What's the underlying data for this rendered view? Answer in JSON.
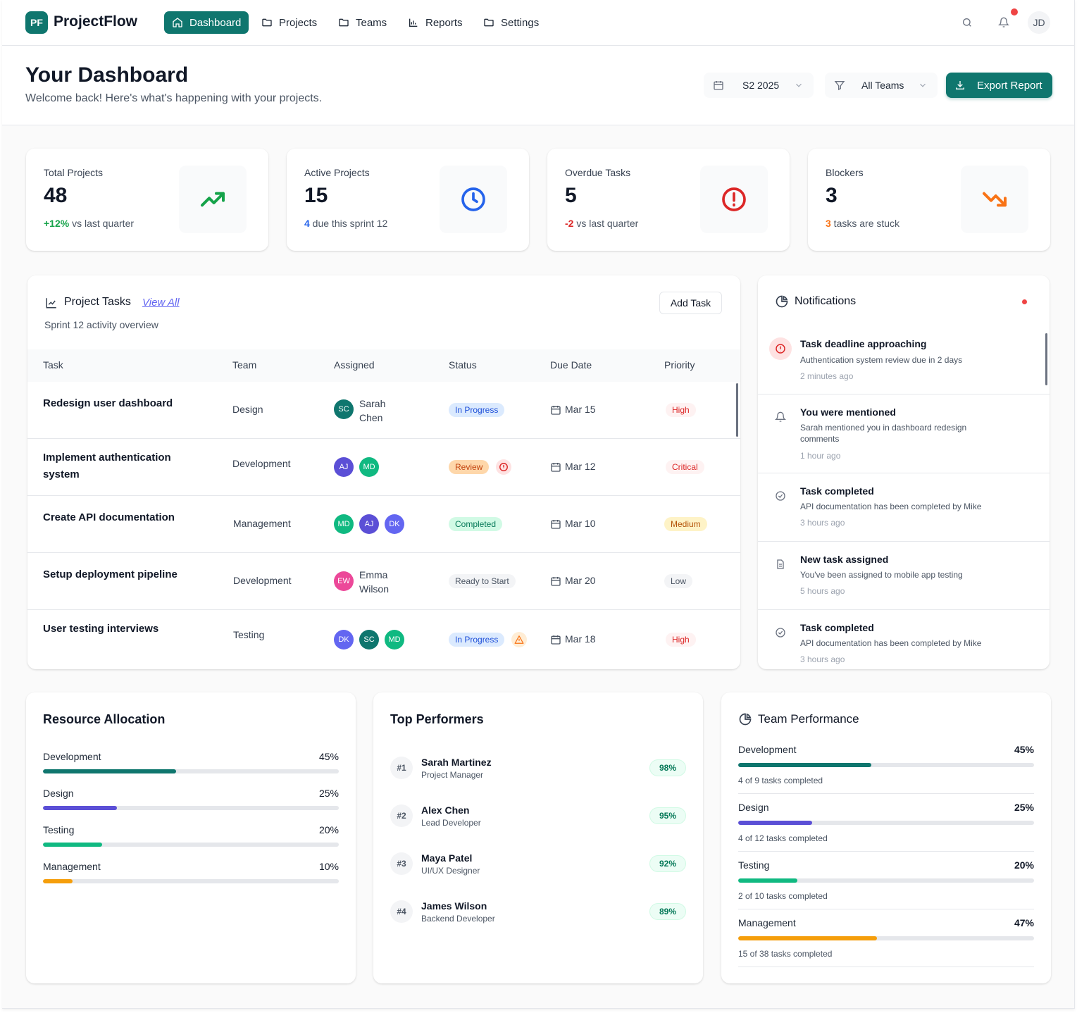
{
  "app": {
    "logo_initials": "PF",
    "name": "ProjectFlow",
    "user_initials": "JD"
  },
  "nav": [
    {
      "label": "Dashboard",
      "icon": "home-icon",
      "active": true
    },
    {
      "label": "Projects",
      "icon": "folder-icon"
    },
    {
      "label": "Teams",
      "icon": "folder-icon"
    },
    {
      "label": "Reports",
      "icon": "bar-chart-icon"
    },
    {
      "label": "Settings",
      "icon": "folder-icon"
    }
  ],
  "header": {
    "title": "Your Dashboard",
    "subtitle": "Welcome back! Here's what's happening with your projects.",
    "period_select": "S2 2025",
    "team_select": "All Teams",
    "export_label": "Export Report"
  },
  "stats": [
    {
      "label": "Total Projects",
      "value": "48",
      "highlight": "+12%",
      "note": " vs last quarter",
      "highlight_color": "#16a34a",
      "icon": "trending-up-icon"
    },
    {
      "label": "Active Projects",
      "value": "15",
      "highlight": "4",
      "note": " due this sprint 12",
      "highlight_color": "#2563eb",
      "icon": "clock-icon"
    },
    {
      "label": "Overdue Tasks",
      "value": "5",
      "highlight": "-2",
      "note": " vs last quarter",
      "highlight_color": "#dc2626",
      "icon": "alert-circle-icon"
    },
    {
      "label": "Blockers",
      "value": "3",
      "highlight": "3",
      "note": " tasks are stuck",
      "highlight_color": "#f97316",
      "icon": "trending-down-icon"
    }
  ],
  "tasks": {
    "title": "Project Tasks",
    "view_all": "View All",
    "subtitle": "Sprint 12 activity overview",
    "add_label": "Add Task",
    "columns": [
      "Task",
      "Team",
      "Assigned",
      "Status",
      "Due Date",
      "Priority"
    ],
    "rows": [
      {
        "task": "Redesign user dashboard",
        "team": "Design",
        "assignees": [
          "SC"
        ],
        "assignee_name": "Sarah Chen",
        "status": "In Progress",
        "status_icon": "",
        "due": "Mar 15",
        "priority": "High"
      },
      {
        "task": "Implement authentication system",
        "team": "Development",
        "assignees": [
          "AJ",
          "MD"
        ],
        "assignee_name": "",
        "status": "Review",
        "status_icon": "alert-circle-icon",
        "due": "Mar 12",
        "priority": "Critical"
      },
      {
        "task": "Create API documentation",
        "team": "Management",
        "assignees": [
          "MD",
          "AJ",
          "DK"
        ],
        "assignee_name": "",
        "status": "Completed",
        "status_icon": "",
        "due": "Mar 10",
        "priority": "Medium"
      },
      {
        "task": "Setup deployment pipeline",
        "team": "Development",
        "assignees": [
          "EW"
        ],
        "assignee_name": "Emma Wilson",
        "status": "Ready to Start",
        "status_icon": "",
        "due": "Mar 20",
        "priority": "Low"
      },
      {
        "task": "User testing interviews",
        "team": "Testing",
        "assignees": [
          "DK",
          "SC",
          "MD"
        ],
        "assignee_name": "",
        "status": "In Progress",
        "status_icon": "warning-icon",
        "due": "Mar 18",
        "priority": "High"
      }
    ]
  },
  "notifications": {
    "title": "Notifications",
    "items": [
      {
        "title": "Task deadline approaching",
        "desc": "Authentication system review due in 2 days",
        "time": "2 minutes ago",
        "icon": "alert-circle-icon"
      },
      {
        "title": "You were mentioned",
        "desc": "Sarah mentioned you in dashboard redesign comments",
        "time": "1 hour ago",
        "icon": "bell-icon"
      },
      {
        "title": "Task completed",
        "desc": "API documentation has been completed by Mike",
        "time": "3 hours ago",
        "icon": "check-circle-icon"
      },
      {
        "title": "New task assigned",
        "desc": "You've been assigned to mobile app testing",
        "time": "5 hours ago",
        "icon": "document-icon"
      },
      {
        "title": "Task completed",
        "desc": "API documentation has been completed by Mike",
        "time": "3 hours ago",
        "icon": "check-circle-icon"
      }
    ]
  },
  "resource": {
    "title": "Resource Allocation",
    "items": [
      {
        "label": "Development",
        "pct": "45%",
        "value": 45,
        "color": "#0f766e"
      },
      {
        "label": "Design",
        "pct": "25%",
        "value": 25,
        "color": "#5b4fd6"
      },
      {
        "label": "Testing",
        "pct": "20%",
        "value": 20,
        "color": "#10b981"
      },
      {
        "label": "Management",
        "pct": "10%",
        "value": 10,
        "color": "#f59e0b"
      }
    ]
  },
  "performers": {
    "title": "Top Performers",
    "items": [
      {
        "rank": "#1",
        "name": "Sarah Martinez",
        "role": "Project Manager",
        "score": "98%"
      },
      {
        "rank": "#2",
        "name": "Alex Chen",
        "role": "Lead Developer",
        "score": "95%"
      },
      {
        "rank": "#3",
        "name": "Maya Patel",
        "role": "UI/UX Designer",
        "score": "92%"
      },
      {
        "rank": "#4",
        "name": "James Wilson",
        "role": "Backend Developer",
        "score": "89%"
      }
    ]
  },
  "team_perf": {
    "title": "Team Performance",
    "items": [
      {
        "label": "Development",
        "pct": "45%",
        "value": 45,
        "note": "4 of 9 tasks completed",
        "color": "#0f766e"
      },
      {
        "label": "Design",
        "pct": "25%",
        "value": 25,
        "note": "4 of 12 tasks completed",
        "color": "#5b4fd6"
      },
      {
        "label": "Testing",
        "pct": "20%",
        "value": 20,
        "note": "2 of 10 tasks completed",
        "color": "#10b981"
      },
      {
        "label": "Management",
        "pct": "47%",
        "value": 47,
        "note": "15 of 38 tasks completed",
        "color": "#f59e0b"
      }
    ]
  },
  "colors": {
    "accent": "#0f766e",
    "danger": "#ef4444"
  }
}
